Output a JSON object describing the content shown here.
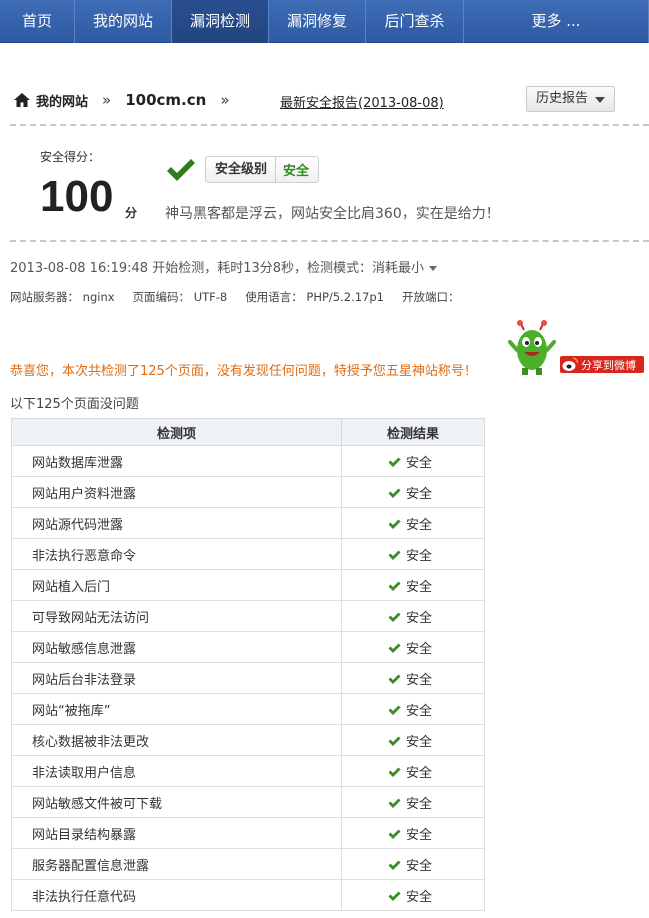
{
  "nav": [
    {
      "label": "首页",
      "name": "nav-home"
    },
    {
      "label": "我的网站",
      "name": "nav-my-sites"
    },
    {
      "label": "漏洞检测",
      "name": "nav-vuln-scan",
      "active": true
    },
    {
      "label": "漏洞修复",
      "name": "nav-vuln-fix"
    },
    {
      "label": "后门查杀",
      "name": "nav-backdoor-scan"
    },
    {
      "label": "更多 ...",
      "name": "nav-more"
    }
  ],
  "breadcrumb": {
    "site_label": "我的网站",
    "sep": "»",
    "domain": "100cm.cn",
    "report_link": "最新安全报告(2013-08-08)",
    "history_button": "历史报告"
  },
  "score": {
    "label": "安全得分：",
    "value": "100",
    "unit": "分",
    "level_label": "安全级别",
    "level_value": "安全",
    "slogan": "神马黑客都是浮云，网站安全比肩360，实在是给力！"
  },
  "scan": {
    "summary": "2013-08-08 16:19:48 开始检测，耗时13分8秒，检测模式：消耗最小",
    "server": "网站服务器： nginx",
    "encoding": "页面编码： UTF-8",
    "language": "使用语言： PHP/5.2.17p1",
    "ports": "开放端口："
  },
  "congrats": "恭喜您，本次共检测了125个页面，没有发现任何问题，特授予您五星神站称号！",
  "share_button": "分享到微博",
  "list_title": "以下125个页面没问题",
  "table": {
    "headers": [
      "检测项",
      "检测结果"
    ],
    "rows": [
      {
        "item": "网站数据库泄露",
        "result": "安全"
      },
      {
        "item": "网站用户资料泄露",
        "result": "安全"
      },
      {
        "item": "网站源代码泄露",
        "result": "安全"
      },
      {
        "item": "非法执行恶意命令",
        "result": "安全"
      },
      {
        "item": "网站植入后门",
        "result": "安全"
      },
      {
        "item": "可导致网站无法访问",
        "result": "安全"
      },
      {
        "item": "网站敏感信息泄露",
        "result": "安全"
      },
      {
        "item": "网站后台非法登录",
        "result": "安全"
      },
      {
        "item": "网站“被拖库”",
        "result": "安全"
      },
      {
        "item": "核心数据被非法更改",
        "result": "安全"
      },
      {
        "item": "非法读取用户信息",
        "result": "安全"
      },
      {
        "item": "网站敏感文件被可下载",
        "result": "安全"
      },
      {
        "item": "网站目录结构暴露",
        "result": "安全"
      },
      {
        "item": "服务器配置信息泄露",
        "result": "安全"
      },
      {
        "item": "非法执行任意代码",
        "result": "安全"
      }
    ]
  },
  "colors": {
    "nav_bg": "#2d5aa1",
    "safe_green": "#2e8b1e",
    "congrats_orange": "#e06b12",
    "share_red": "#d7261d"
  }
}
